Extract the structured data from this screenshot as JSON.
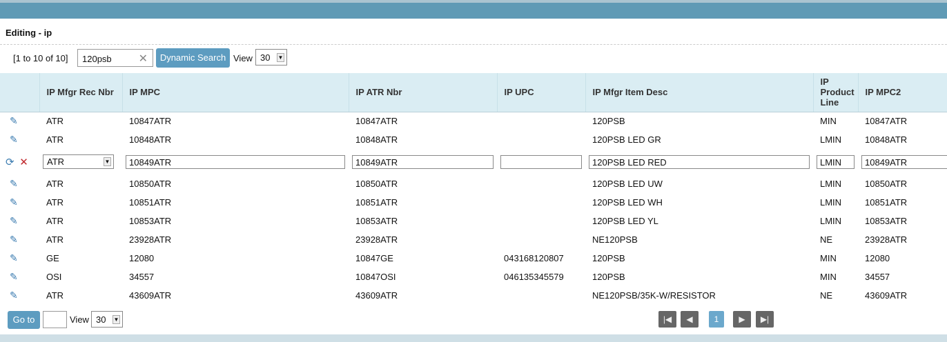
{
  "title": "Editing - ip",
  "toolbar": {
    "count": "[1 to 10 of 10]",
    "search_value": "120psb",
    "search_button": "Dynamic Search",
    "view_label": "View",
    "view_value": "30"
  },
  "columns": [
    "IP Mfgr Rec Nbr",
    "IP MPC",
    "IP ATR Nbr",
    "IP UPC",
    "IP Mfgr Item Desc",
    "IP Product Line",
    "IP MPC2"
  ],
  "rows": [
    [
      "ATR",
      "10847ATR",
      "10847ATR",
      "",
      "120PSB",
      "MIN",
      "10847ATR"
    ],
    [
      "ATR",
      "10848ATR",
      "10848ATR",
      "",
      "120PSB LED GR",
      "LMIN",
      "10848ATR"
    ],
    [
      "ATR",
      "10849ATR",
      "10849ATR",
      "",
      "120PSB LED RED",
      "LMIN",
      "10849ATR"
    ],
    [
      "ATR",
      "10850ATR",
      "10850ATR",
      "",
      "120PSB LED UW",
      "LMIN",
      "10850ATR"
    ],
    [
      "ATR",
      "10851ATR",
      "10851ATR",
      "",
      "120PSB LED WH",
      "LMIN",
      "10851ATR"
    ],
    [
      "ATR",
      "10853ATR",
      "10853ATR",
      "",
      "120PSB LED YL",
      "LMIN",
      "10853ATR"
    ],
    [
      "ATR",
      "23928ATR",
      "23928ATR",
      "",
      "NE120PSB",
      "NE",
      "23928ATR"
    ],
    [
      "GE",
      "12080",
      "10847GE",
      "043168120807",
      "120PSB",
      "MIN",
      "12080"
    ],
    [
      "OSI",
      "34557",
      "10847OSI",
      "046135345579",
      "120PSB",
      "MIN",
      "34557"
    ],
    [
      "ATR",
      "43609ATR",
      "43609ATR",
      "",
      "NE120PSB/35K-W/RESISTOR",
      "NE",
      "43609ATR"
    ]
  ],
  "editing_row_index": 2,
  "footer": {
    "goto_label": "Go to",
    "goto_value": "",
    "view_label": "View",
    "view_value": "30",
    "current_page": "1"
  }
}
